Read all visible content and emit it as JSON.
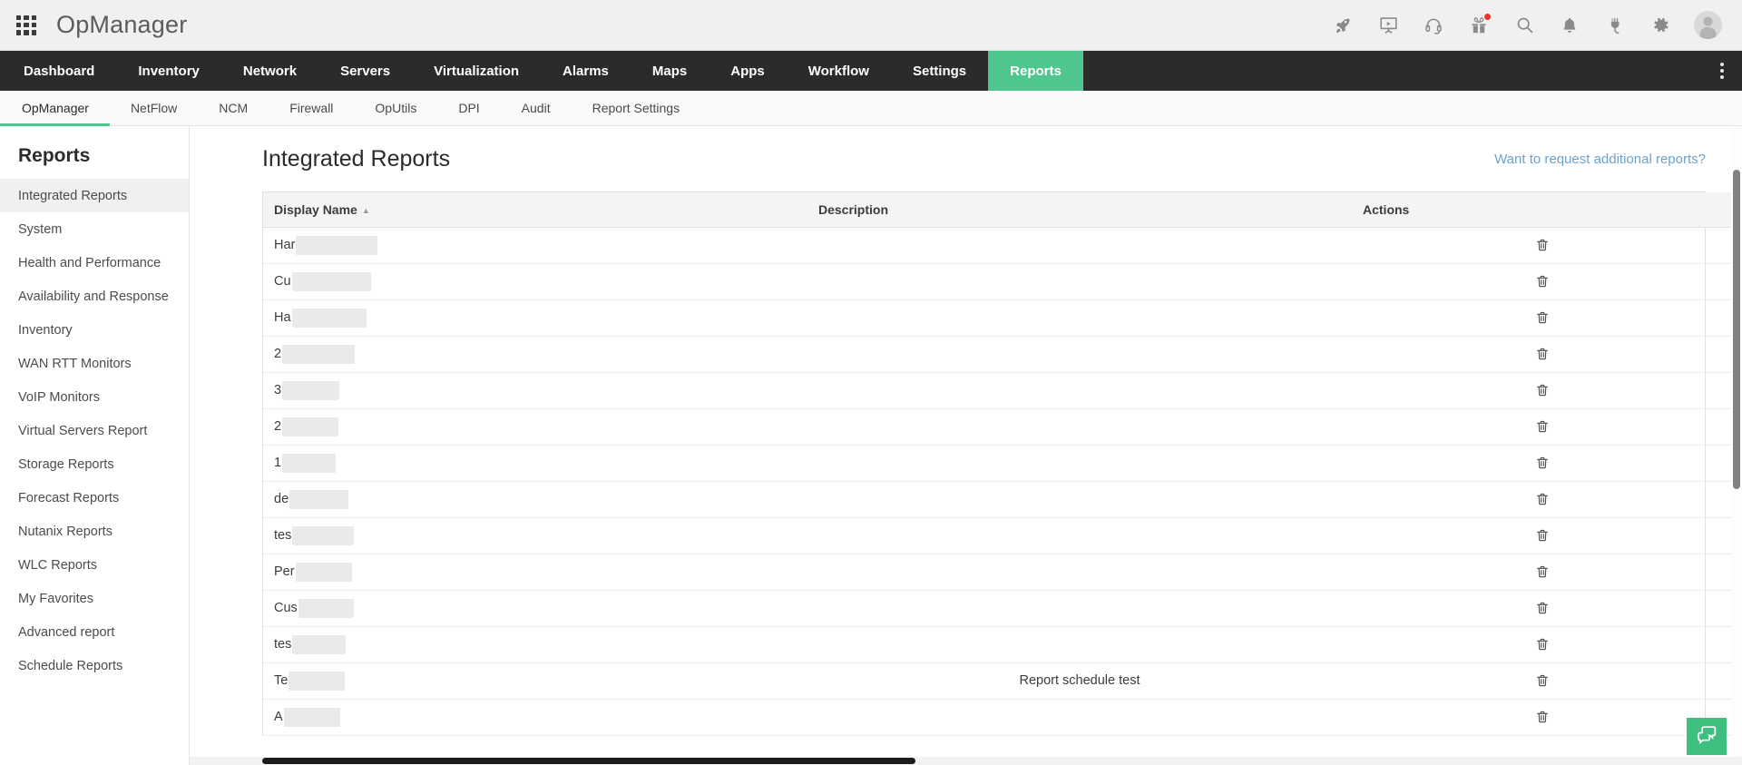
{
  "header": {
    "brand": "OpManager",
    "grid_icon": "app-grid-icon",
    "icons": [
      {
        "name": "rocket-icon",
        "label": "What's New"
      },
      {
        "name": "presentation-icon",
        "label": "Demo Videos"
      },
      {
        "name": "headset-icon",
        "label": "Support"
      },
      {
        "name": "gift-icon",
        "label": "Offers",
        "badge": true
      },
      {
        "name": "search-icon",
        "label": "Search"
      },
      {
        "name": "bell-icon",
        "label": "Notifications"
      },
      {
        "name": "plug-icon",
        "label": "Integrations"
      },
      {
        "name": "gear-icon",
        "label": "Settings"
      },
      {
        "name": "avatar-icon",
        "label": "User Profile"
      }
    ]
  },
  "main_nav": {
    "items": [
      {
        "label": "Dashboard",
        "active": false
      },
      {
        "label": "Inventory",
        "active": false
      },
      {
        "label": "Network",
        "active": false
      },
      {
        "label": "Servers",
        "active": false
      },
      {
        "label": "Virtualization",
        "active": false
      },
      {
        "label": "Alarms",
        "active": false
      },
      {
        "label": "Maps",
        "active": false
      },
      {
        "label": "Apps",
        "active": false
      },
      {
        "label": "Workflow",
        "active": false
      },
      {
        "label": "Settings",
        "active": false
      },
      {
        "label": "Reports",
        "active": true
      }
    ],
    "active_color": "#4fc68d",
    "overflow_icon": "kebab-menu-icon"
  },
  "sub_nav": {
    "items": [
      {
        "label": "OpManager",
        "active": true
      },
      {
        "label": "NetFlow",
        "active": false
      },
      {
        "label": "NCM",
        "active": false
      },
      {
        "label": "Firewall",
        "active": false
      },
      {
        "label": "OpUtils",
        "active": false
      },
      {
        "label": "DPI",
        "active": false
      },
      {
        "label": "Audit",
        "active": false
      },
      {
        "label": "Report Settings",
        "active": false
      }
    ]
  },
  "sidebar": {
    "title": "Reports",
    "items": [
      {
        "label": "Integrated Reports",
        "active": true
      },
      {
        "label": "System",
        "active": false
      },
      {
        "label": "Health and Performance",
        "active": false
      },
      {
        "label": "Availability and Response",
        "active": false
      },
      {
        "label": "Inventory",
        "active": false
      },
      {
        "label": "WAN RTT Monitors",
        "active": false
      },
      {
        "label": "VoIP Monitors",
        "active": false
      },
      {
        "label": "Virtual Servers Report",
        "active": false
      },
      {
        "label": "Storage Reports",
        "active": false
      },
      {
        "label": "Forecast Reports",
        "active": false
      },
      {
        "label": "Nutanix Reports",
        "active": false
      },
      {
        "label": "WLC Reports",
        "active": false
      },
      {
        "label": "My Favorites",
        "active": false
      },
      {
        "label": "Advanced report",
        "active": false
      },
      {
        "label": "Schedule Reports",
        "active": false
      }
    ]
  },
  "main": {
    "page_title": "Integrated Reports",
    "request_link": "Want to request additional reports?",
    "link_color": "#6ba3cf",
    "table": {
      "columns": [
        "Display Name",
        "Description",
        "Actions"
      ],
      "sort_column": "Display Name",
      "sort_direction": "asc",
      "search_icon": "search-icon",
      "action_icon": "trash-icon",
      "rows": [
        {
          "name_prefix": "Har",
          "redacted_width": 90,
          "description": "",
          "action": "delete"
        },
        {
          "name_prefix": "Cu",
          "redacted_width": 87,
          "description": "",
          "action": "delete"
        },
        {
          "name_prefix": "Ha",
          "redacted_width": 82,
          "description": "",
          "action": "delete"
        },
        {
          "name_prefix": "2",
          "redacted_width": 80,
          "description": "",
          "action": "delete"
        },
        {
          "name_prefix": "3",
          "redacted_width": 63,
          "description": "",
          "action": "delete"
        },
        {
          "name_prefix": "2",
          "redacted_width": 62,
          "description": "",
          "action": "delete"
        },
        {
          "name_prefix": "1",
          "redacted_width": 59,
          "description": "",
          "action": "delete"
        },
        {
          "name_prefix": "de",
          "redacted_width": 65,
          "description": "",
          "action": "delete"
        },
        {
          "name_prefix": "tes",
          "redacted_width": 68,
          "description": "",
          "action": "delete"
        },
        {
          "name_prefix": "Per",
          "redacted_width": 62,
          "description": "",
          "action": "delete"
        },
        {
          "name_prefix": "Cus",
          "redacted_width": 61,
          "description": "",
          "action": "delete"
        },
        {
          "name_prefix": "tes",
          "redacted_width": 59,
          "description": "",
          "action": "delete"
        },
        {
          "name_prefix": "Te",
          "redacted_width": 62,
          "description": "Report schedule test",
          "action": "delete"
        },
        {
          "name_prefix": "A",
          "redacted_width": 62,
          "description": "",
          "action": "delete"
        }
      ]
    }
  },
  "chat_widget": {
    "icon": "chat-bubbles-icon",
    "color": "#3fbf7f"
  },
  "scrollbars": {
    "vertical_visible": true,
    "horizontal_visible": true
  }
}
